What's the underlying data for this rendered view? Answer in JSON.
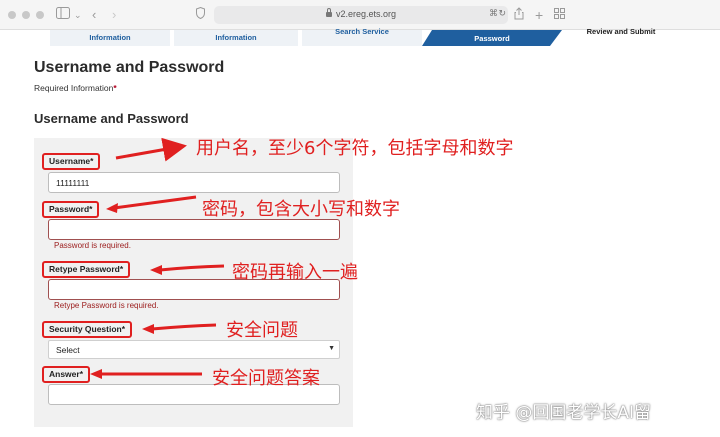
{
  "browser": {
    "url": "v2.ereg.ets.org",
    "icons": [
      "window-dot-icon",
      "sidebar-icon",
      "back-icon",
      "forward-icon",
      "privacy-shield-icon",
      "lock-icon",
      "translate-icon",
      "share-icon",
      "new-tab-icon",
      "tab-overview-icon"
    ]
  },
  "steps": [
    {
      "label": "Information",
      "state": "done"
    },
    {
      "label": "Information",
      "state": "done"
    },
    {
      "label": "Search Service",
      "state": "done"
    },
    {
      "label": "Password",
      "state": "active"
    },
    {
      "label": "Review and Submit",
      "state": "upcoming"
    }
  ],
  "page": {
    "title": "Username and Password",
    "required_note": "Required Information",
    "required_star": "*",
    "section_title": "Username and Password"
  },
  "form": {
    "username": {
      "label": "Username*",
      "value": "11111111"
    },
    "password": {
      "label": "Password*",
      "value": "",
      "error": "Password is required."
    },
    "retype_password": {
      "label": "Retype Password*",
      "value": "",
      "error": "Retype Password is required."
    },
    "security_question": {
      "label": "Security Question*",
      "selected": "Select"
    },
    "answer": {
      "label": "Answer*",
      "value": ""
    }
  },
  "annotations": {
    "username": "用户名，至少6个字符，包括字母和数字",
    "password": "密码，包含大小写和数字",
    "retype_password": "密码再输入一遍",
    "security_question": "安全问题",
    "answer": "安全问题答案"
  },
  "colors": {
    "annotation_red": "#e02020",
    "active_step": "#1f5f9f",
    "error_text": "#9b1b1b"
  },
  "watermark": "知乎 @回国老学长AI留"
}
